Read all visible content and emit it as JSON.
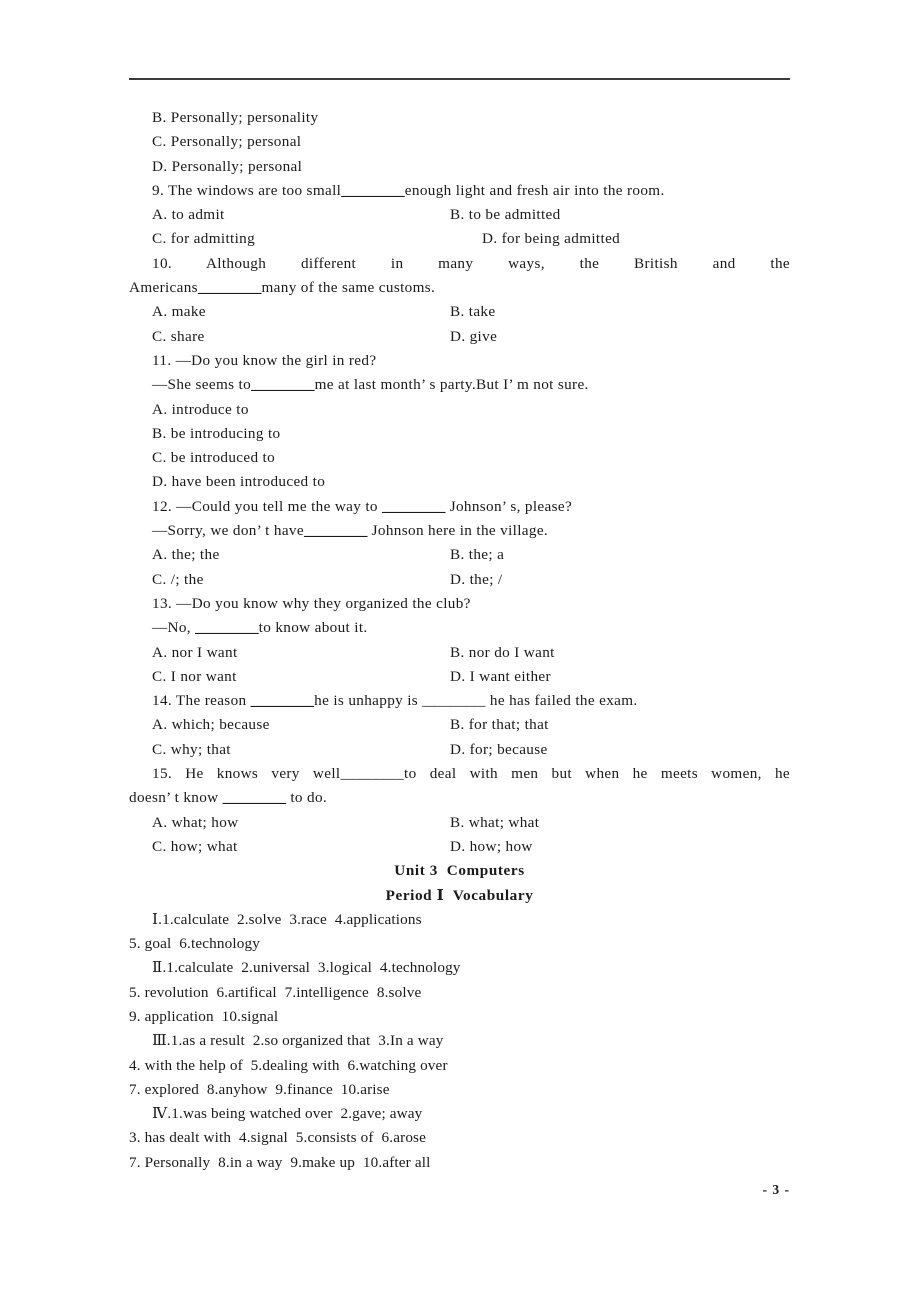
{
  "document": {
    "page_number": "- 3 -",
    "header_rule": true
  },
  "questions": [
    {
      "type": "option",
      "text": "B. Personally; personality"
    },
    {
      "type": "option",
      "text": "C. Personally; personal"
    },
    {
      "type": "option",
      "text": "D. Personally; personal"
    },
    {
      "type": "stem",
      "text": "9. The windows are too small",
      "blank": "________",
      "text2": "enough light and fresh air into the room."
    },
    {
      "type": "option2",
      "left": "A. to admit",
      "right": "B. to be admitted",
      "gap": 170
    },
    {
      "type": "option2",
      "left": "C. for admitting",
      "right": "D. for being admitted",
      "gap": 210
    },
    {
      "type": "justified",
      "text": "10. Although different in many ways, the British and the"
    },
    {
      "type": "cont",
      "text": "Americans",
      "blank": "________",
      "text2": "many of the same customs."
    },
    {
      "type": "option2",
      "left": "A. make",
      "right": "B. take",
      "gap": 195
    },
    {
      "type": "option2",
      "left": "C. share",
      "right": "D. give",
      "gap": 195
    },
    {
      "type": "stem_plain",
      "text": "11. —Do you know the girl in red?"
    },
    {
      "type": "cont_blank",
      "text": "—She seems to",
      "blank": "________",
      "text2": "me at last month’ s party.But I’ m not sure."
    },
    {
      "type": "option",
      "text": "A. introduce to"
    },
    {
      "type": "option",
      "text": "B. be introducing to"
    },
    {
      "type": "option",
      "text": "C. be introduced to"
    },
    {
      "type": "option",
      "text": "D. have been introduced to"
    },
    {
      "type": "stem",
      "text": "12. —Could you tell me the way to ",
      "blank": "________",
      "text2": " Johnson’ s, please?"
    },
    {
      "type": "cont_blank",
      "text": "—Sorry, we don’ t have",
      "blank": "________",
      "text2": " Johnson here in the village."
    },
    {
      "type": "option2",
      "left": "A. the; the",
      "right": "B. the; a",
      "gap": 170
    },
    {
      "type": "option2",
      "left": "C. /; the",
      "right": "D. the; /",
      "gap": 178
    },
    {
      "type": "stem_plain",
      "text": "13. —Do you know why they organized the club?"
    },
    {
      "type": "cont_blank",
      "text": "—No, ",
      "blank": "________",
      "text2": "to know about it."
    },
    {
      "type": "option2",
      "left": "A. nor I want",
      "right": "B. nor do I want",
      "gap": 170
    },
    {
      "type": "option2",
      "left": "C. I nor want",
      "right": "D. I want either",
      "gap": 170
    },
    {
      "type": "stem",
      "text": "14. The reason ",
      "blank": "________",
      "text2": "he is unhappy is ________ he has failed the exam."
    },
    {
      "type": "option2",
      "left": "A. which; because",
      "right": "B. for that; that",
      "gap": 170
    },
    {
      "type": "option2",
      "left": "C. why; that",
      "right": "D. for; because",
      "gap": 170
    },
    {
      "type": "justified",
      "text": "15. He knows very well________to deal with men but when he meets women, he"
    },
    {
      "type": "cont_blank2",
      "text": "doesn’ t know ",
      "blank": "________",
      "text2": " to do."
    },
    {
      "type": "option2",
      "left": "A. what; how",
      "right": "B. what; what",
      "gap": 170
    },
    {
      "type": "option2",
      "left": "C. how; what",
      "right": "D. how; how",
      "gap": 170
    }
  ],
  "headings": {
    "unit": "Unit 3  Computers",
    "period": "Period Ⅰ  Vocabulary"
  },
  "answer_key": [
    {
      "indent": true,
      "text": "Ⅰ.1.calculate  2.solve  3.race  4.applications"
    },
    {
      "indent": false,
      "text": "5. goal  6.technology"
    },
    {
      "indent": true,
      "text": "Ⅱ.1.calculate  2.universal  3.logical  4.technology"
    },
    {
      "indent": false,
      "text": "5. revolution  6.artifical  7.intelligence  8.solve"
    },
    {
      "indent": false,
      "text": "9. application  10.signal"
    },
    {
      "indent": true,
      "text": "Ⅲ.1.as a result  2.so organized that  3.In a way"
    },
    {
      "indent": false,
      "text": "4. with the help of  5.dealing with  6.watching over"
    },
    {
      "indent": false,
      "text": "7. explored  8.anyhow  9.finance  10.arise"
    },
    {
      "indent": true,
      "text": "Ⅳ.1.was being watched over  2.gave; away"
    },
    {
      "indent": false,
      "text": "3. has dealt with  4.signal  5.consists of  6.arose"
    },
    {
      "indent": false,
      "text": "7. Personally  8.in a way  9.make up  10.after all"
    }
  ]
}
